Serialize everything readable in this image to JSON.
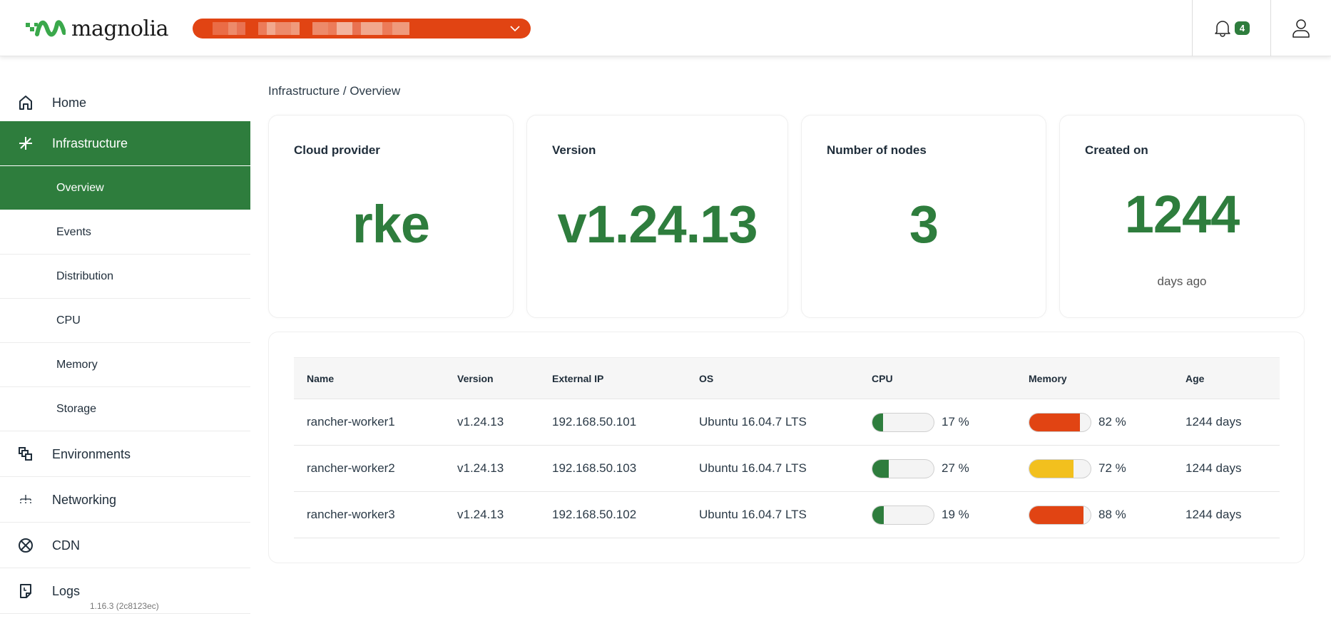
{
  "header": {
    "logo_text": "magnolia",
    "environment_selector": {
      "value": "[redacted]",
      "icon": "chevron-down-icon"
    },
    "notifications": {
      "icon": "bell-icon",
      "count": "4"
    },
    "user": {
      "icon": "user-icon"
    }
  },
  "sidebar": {
    "items": [
      {
        "label": "Home",
        "icon": "home-icon",
        "active": false
      },
      {
        "label": "Infrastructure",
        "icon": "asterisk-icon",
        "active": true,
        "children": [
          {
            "label": "Overview",
            "active": true
          },
          {
            "label": "Events",
            "active": false
          },
          {
            "label": "Distribution",
            "active": false
          },
          {
            "label": "CPU",
            "active": false
          },
          {
            "label": "Memory",
            "active": false
          },
          {
            "label": "Storage",
            "active": false
          }
        ]
      },
      {
        "label": "Environments",
        "icon": "environments-icon",
        "active": false
      },
      {
        "label": "Networking",
        "icon": "network-icon",
        "active": false
      },
      {
        "label": "CDN",
        "icon": "globe-icon",
        "active": false
      },
      {
        "label": "Logs",
        "icon": "logs-icon",
        "active": false
      }
    ],
    "version": "1.16.3 (2c8123ec)"
  },
  "breadcrumb": "Infrastructure / Overview",
  "cards": [
    {
      "title": "Cloud provider",
      "value": "rke",
      "sub": ""
    },
    {
      "title": "Version",
      "value": "v1.24.13",
      "sub": ""
    },
    {
      "title": "Number of nodes",
      "value": "3",
      "sub": ""
    },
    {
      "title": "Created on",
      "value": "1244",
      "sub": "days ago"
    }
  ],
  "table": {
    "columns": [
      "Name",
      "Version",
      "External IP",
      "OS",
      "CPU",
      "Memory",
      "Age"
    ],
    "rows": [
      {
        "name": "rancher-worker1",
        "version": "v1.24.13",
        "ip": "192.168.50.101",
        "os": "Ubuntu 16.04.7 LTS",
        "cpu": 17,
        "cpu_label": "17 %",
        "memory": 82,
        "memory_label": "82 %",
        "age": "1244 days"
      },
      {
        "name": "rancher-worker2",
        "version": "v1.24.13",
        "ip": "192.168.50.103",
        "os": "Ubuntu 16.04.7 LTS",
        "cpu": 27,
        "cpu_label": "27 %",
        "memory": 72,
        "memory_label": "72 %",
        "age": "1244 days"
      },
      {
        "name": "rancher-worker3",
        "version": "v1.24.13",
        "ip": "192.168.50.102",
        "os": "Ubuntu 16.04.7 LTS",
        "cpu": 19,
        "cpu_label": "19 %",
        "memory": 88,
        "memory_label": "88 %",
        "age": "1244 days"
      }
    ]
  },
  "colors": {
    "brand_green": "#2e7d3d",
    "accent_orange": "#e14413",
    "warning_yellow": "#f2c01e",
    "danger_orange": "#e14413"
  }
}
